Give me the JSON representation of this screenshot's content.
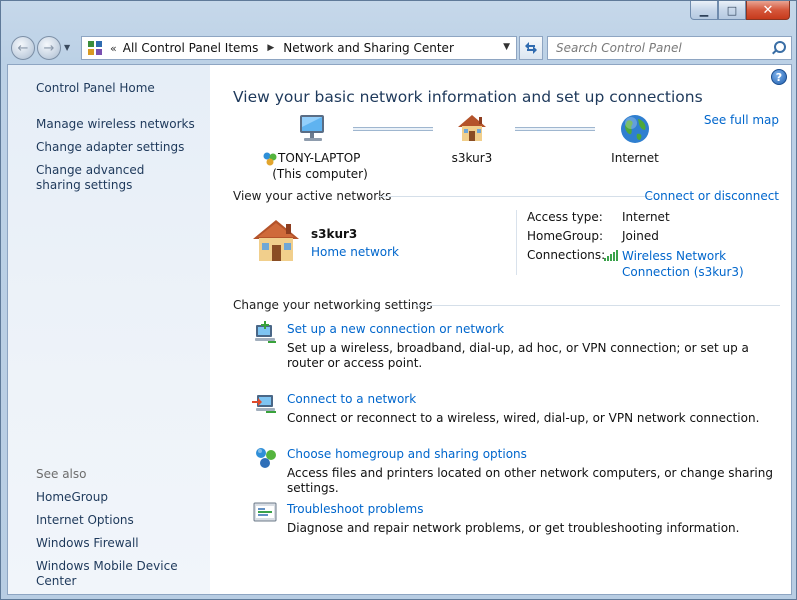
{
  "window": {
    "caption": {
      "minimize": "▁",
      "maximize": "□",
      "close": "✕"
    }
  },
  "nav": {
    "back": "←",
    "forward": "→",
    "chevron": "«",
    "breadcrumb": [
      "All Control Panel Items",
      "Network and Sharing Center"
    ],
    "search_placeholder": "Search Control Panel"
  },
  "sidebar": {
    "home": "Control Panel Home",
    "links": [
      "Manage wireless networks",
      "Change adapter settings",
      "Change advanced sharing settings"
    ],
    "see_also_heading": "See also",
    "see_also": [
      "HomeGroup",
      "Internet Options",
      "Windows Firewall",
      "Windows Mobile Device Center"
    ]
  },
  "main": {
    "title": "View your basic network information and set up connections",
    "see_full_map": "See full map",
    "map": {
      "computer_name": "TONY-LAPTOP",
      "computer_sub": "(This computer)",
      "network": "s3kur3",
      "internet": "Internet"
    },
    "active": {
      "heading": "View your active networks",
      "connect_link": "Connect or disconnect",
      "name": "s3kur3",
      "type": "Home network",
      "labels": {
        "access": "Access type:",
        "homegroup": "HomeGroup:",
        "connections": "Connections:"
      },
      "values": {
        "access": "Internet",
        "homegroup": "Joined",
        "connections": "Wireless Network Connection (s3kur3)"
      }
    },
    "settings_heading": "Change your networking settings",
    "tasks": [
      {
        "title": "Set up a new connection or network",
        "desc": "Set up a wireless, broadband, dial-up, ad hoc, or VPN connection; or set up a router or access point."
      },
      {
        "title": "Connect to a network",
        "desc": "Connect or reconnect to a wireless, wired, dial-up, or VPN network connection."
      },
      {
        "title": "Choose homegroup and sharing options",
        "desc": "Access files and printers located on other network computers, or change sharing settings."
      },
      {
        "title": "Troubleshoot problems",
        "desc": "Diagnose and repair network problems, or get troubleshooting information."
      }
    ]
  },
  "icons": [
    "control-panel-icon",
    "refresh-icon",
    "search-icon",
    "help-icon",
    "computer-icon",
    "home-network-icon",
    "internet-globe-icon",
    "homegroup-icon",
    "wireless-signal-icon",
    "new-connection-icon",
    "connect-network-icon",
    "homegroup-options-icon",
    "troubleshoot-icon"
  ]
}
